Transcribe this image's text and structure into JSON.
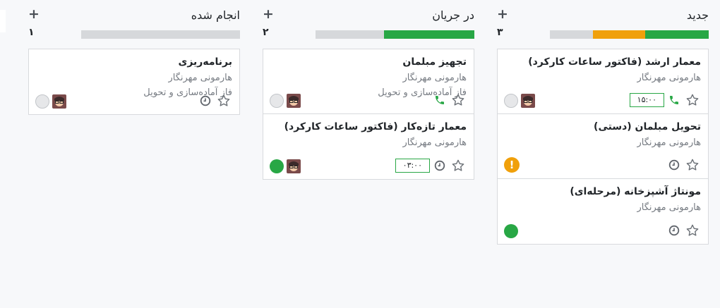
{
  "colors": {
    "green": "#28a745",
    "orange": "#f0a00b",
    "grey": "#d6d8db"
  },
  "columns": [
    {
      "title": "جدید",
      "count": "۳",
      "progress": [
        {
          "status": "done",
          "fraction": 0.4,
          "color": "#28a745"
        },
        {
          "status": "blocked",
          "fraction": 0.33,
          "color": "#f0a00b"
        },
        {
          "status": "normal",
          "fraction": 0.27,
          "color": "#d6d8db"
        }
      ],
      "cards": [
        {
          "title": "معمار ارشد (فاکتور ساعات کارکرد)",
          "customer": "هارمونی مهرنگار",
          "stage": "",
          "hours": "۱۵:۰۰",
          "phone": true,
          "status": "none"
        },
        {
          "title": "تحویل مبلمان (دستی)",
          "customer": "هارمونی مهرنگار",
          "stage": "",
          "hours": "",
          "phone": false,
          "status": "warn"
        },
        {
          "title": "مونتاژ آشپزخانه (مرحله‌ای)",
          "customer": "هارمونی مهرنگار",
          "stage": "",
          "hours": "",
          "phone": false,
          "status": "green"
        }
      ]
    },
    {
      "title": "در جریان",
      "count": "۲",
      "progress": [
        {
          "status": "done",
          "fraction": 0.57,
          "color": "#28a745"
        },
        {
          "status": "normal",
          "fraction": 0.43,
          "color": "#d6d8db"
        }
      ],
      "cards": [
        {
          "title": "تجهیز مبلمان",
          "customer": "هارمونی مهرنگار",
          "stage": "فاز آماده‌سازی و تحویل",
          "hours": "",
          "phone": true,
          "status": "none"
        },
        {
          "title": "معمار تازه‌کار (فاکتور ساعات کارکرد)",
          "customer": "هارمونی مهرنگار",
          "stage": "",
          "hours": "۰۳:۰۰",
          "phone": false,
          "status": "green"
        }
      ]
    },
    {
      "title": "انجام شده",
      "count": "۱",
      "progress": [
        {
          "status": "normal",
          "fraction": 1.0,
          "color": "#d6d8db"
        }
      ],
      "cards": [
        {
          "title": "برنامه‌ریزی",
          "customer": "هارمونی مهرنگار",
          "stage": "فاز آماده‌سازی و تحویل",
          "hours": "",
          "phone": false,
          "status": "none"
        }
      ]
    }
  ],
  "icons": {
    "add": "plus-icon",
    "star": "star-icon",
    "clock": "clock-icon",
    "phone": "phone-icon",
    "avatar": "avatar-icon",
    "warning": "exclamation-icon"
  },
  "warning_glyph": "!"
}
